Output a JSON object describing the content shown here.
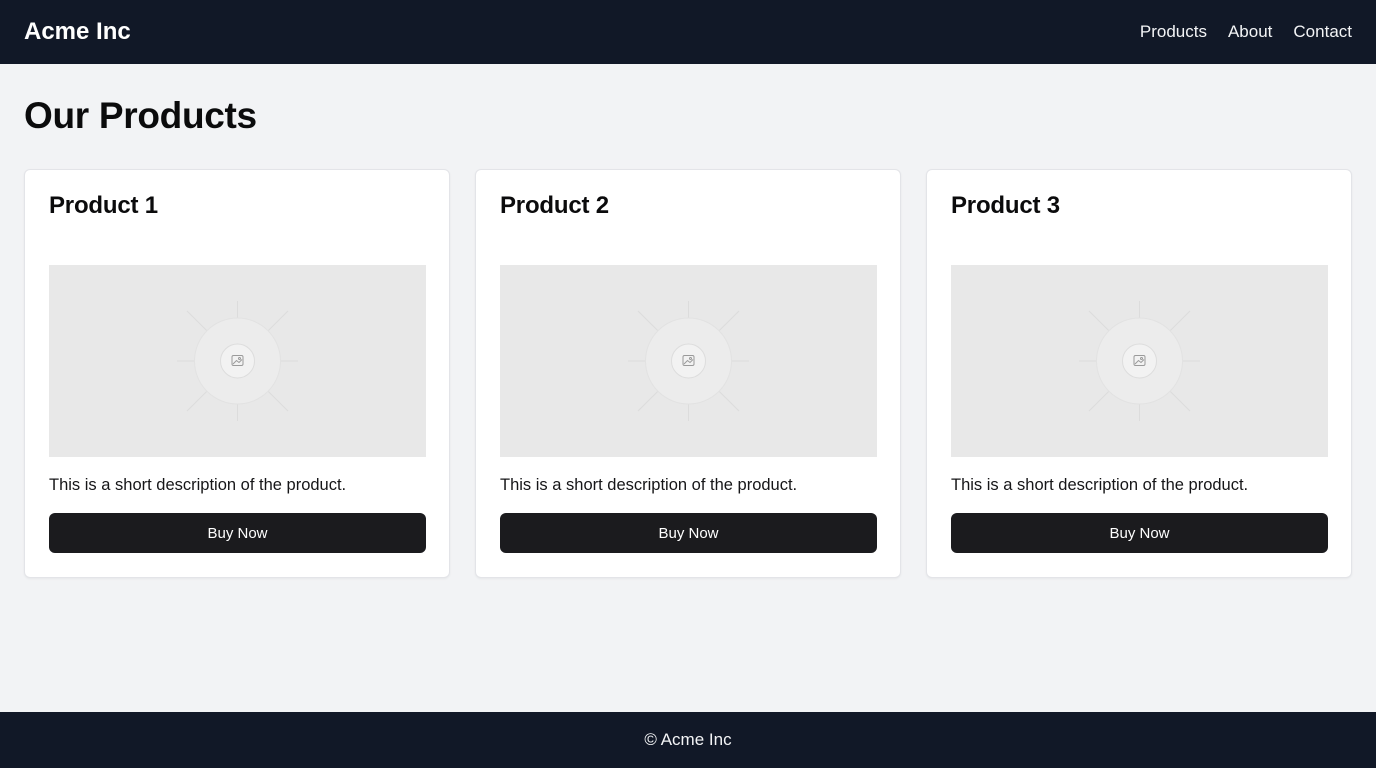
{
  "header": {
    "brand": "Acme Inc",
    "nav": [
      "Products",
      "About",
      "Contact"
    ]
  },
  "main": {
    "title": "Our Products",
    "products": [
      {
        "title": "Product 1",
        "image_icon": "image-placeholder-icon",
        "description": "This is a short description of the product.",
        "button_label": "Buy Now"
      },
      {
        "title": "Product 2",
        "image_icon": "image-placeholder-icon",
        "description": "This is a short description of the product.",
        "button_label": "Buy Now"
      },
      {
        "title": "Product 3",
        "image_icon": "image-placeholder-icon",
        "description": "This is a short description of the product.",
        "button_label": "Buy Now"
      }
    ]
  },
  "footer": {
    "text": "© Acme Inc"
  },
  "colors": {
    "header_bg": "#111827",
    "page_bg": "#f2f3f5",
    "button_bg": "#1b1b1e",
    "placeholder_bg": "#e8e8e8"
  }
}
